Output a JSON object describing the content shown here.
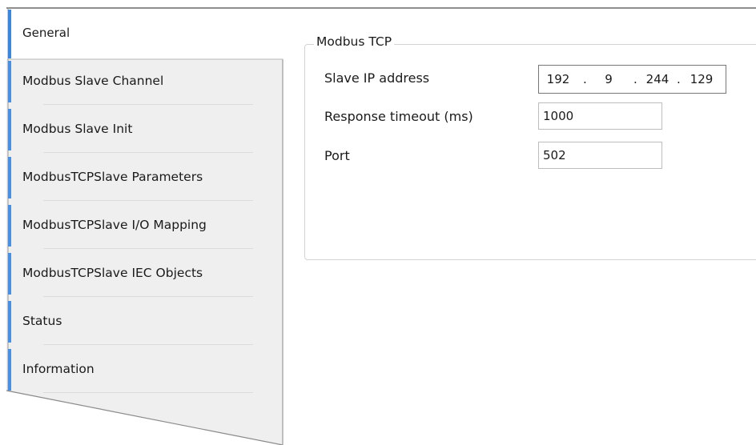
{
  "tabs": [
    {
      "label": "General",
      "active": true
    },
    {
      "label": "Modbus Slave Channel",
      "active": false
    },
    {
      "label": "Modbus Slave Init",
      "active": false
    },
    {
      "label": "ModbusTCPSlave Parameters",
      "active": false
    },
    {
      "label": "ModbusTCPSlave I/O Mapping",
      "active": false
    },
    {
      "label": "ModbusTCPSlave IEC Objects",
      "active": false
    },
    {
      "label": "Status",
      "active": false
    },
    {
      "label": "Information",
      "active": false
    }
  ],
  "group": {
    "title": "Modbus TCP",
    "slave_ip": {
      "label": "Slave IP address",
      "octets": [
        "192",
        "9",
        "244",
        "129"
      ],
      "separator": "."
    },
    "response_timeout": {
      "label": "Response timeout (ms)",
      "value": "1000"
    },
    "port": {
      "label": "Port",
      "value": "502"
    }
  },
  "colors": {
    "tab_accent": "#4a90e2",
    "tab_background": "#efefef",
    "border": "#8e8e8e"
  }
}
